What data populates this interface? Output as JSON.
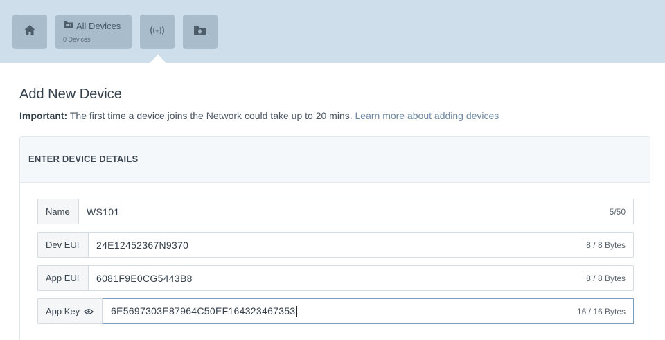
{
  "nav": {
    "all_devices_title": "All Devices",
    "all_devices_count": "0 Devices"
  },
  "page": {
    "title": "Add New Device",
    "notice_bold": "Important:",
    "notice_text": " The first time a device joins the Network could take up to 20 mins. ",
    "notice_link": "Learn more about adding devices"
  },
  "panel": {
    "heading": "ENTER DEVICE DETAILS"
  },
  "fields": {
    "name": {
      "label": "Name",
      "value": "WS101",
      "count": "5/50"
    },
    "dev_eui": {
      "label": "Dev EUI",
      "value": "24E12452367N9370",
      "count": "8 / 8 Bytes"
    },
    "app_eui": {
      "label": "App EUI",
      "value": "6081F9E0CG5443B8",
      "count": "8 / 8 Bytes"
    },
    "app_key": {
      "label": "App Key",
      "value": "6E5697303E87964C50EF164323467353",
      "count": "16 / 16 Bytes"
    }
  },
  "colors": {
    "topbar": "#cfdeeb",
    "tile": "#a9bccc",
    "link": "#6f8aa4",
    "active_border": "#7b9cc4"
  },
  "icons": [
    "home-icon",
    "folder-devices-icon",
    "signal-icon",
    "folder-add-icon",
    "eye-icon"
  ]
}
